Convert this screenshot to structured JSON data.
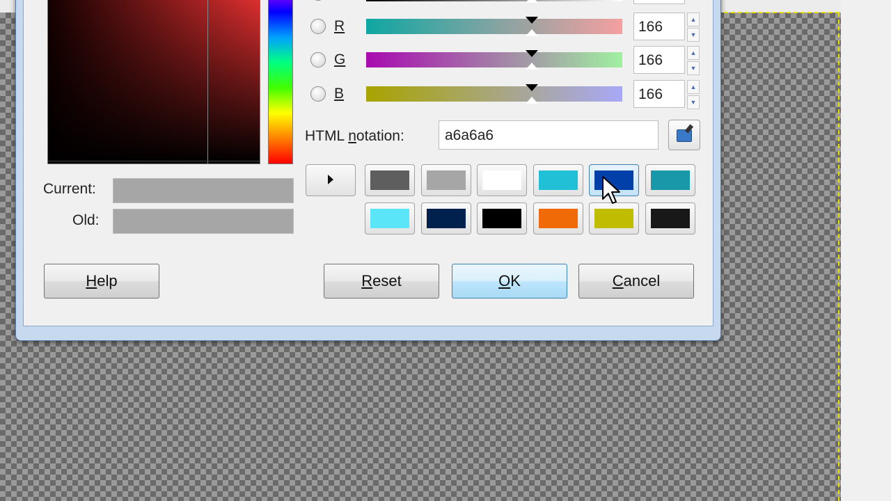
{
  "canvas": {
    "checker_dark": "#6a6a6a",
    "checker_light": "#9a9a9a",
    "border_color": "#e8e000"
  },
  "dialog": {
    "channels": [
      {
        "label": "R",
        "value": "166",
        "gradient_start": "#0fa7a3",
        "gradient_end": "#f5a0a0"
      },
      {
        "label": "G",
        "value": "166",
        "gradient_start": "#a80ab0",
        "gradient_end": "#a0f0a0"
      },
      {
        "label": "B",
        "value": "166",
        "gradient_start": "#a8a400",
        "gradient_end": "#a8a8f8"
      }
    ],
    "html_notation": {
      "label_pre": "HTML ",
      "label_u": "n",
      "label_post": "otation:",
      "value": "a6a6a6"
    },
    "current_label": "Current:",
    "old_label": "Old:",
    "current_color": "#a6a6a6",
    "old_color": "#a6a6a6",
    "palette": [
      [
        "#5e5e5e",
        "#a6a6a6",
        "#ffffff",
        "#22c0d6",
        "#0040a8",
        "#1898a8"
      ],
      [
        "#5ae6f8",
        "#00204e",
        "#000000",
        "#f06a08",
        "#c0bc00",
        "#181818"
      ]
    ],
    "buttons": {
      "help": {
        "u": "H",
        "rest": "elp"
      },
      "reset": {
        "u": "R",
        "rest": "eset"
      },
      "ok": {
        "u": "O",
        "rest": "K"
      },
      "cancel": {
        "u": "C",
        "rest": "ancel"
      }
    }
  }
}
